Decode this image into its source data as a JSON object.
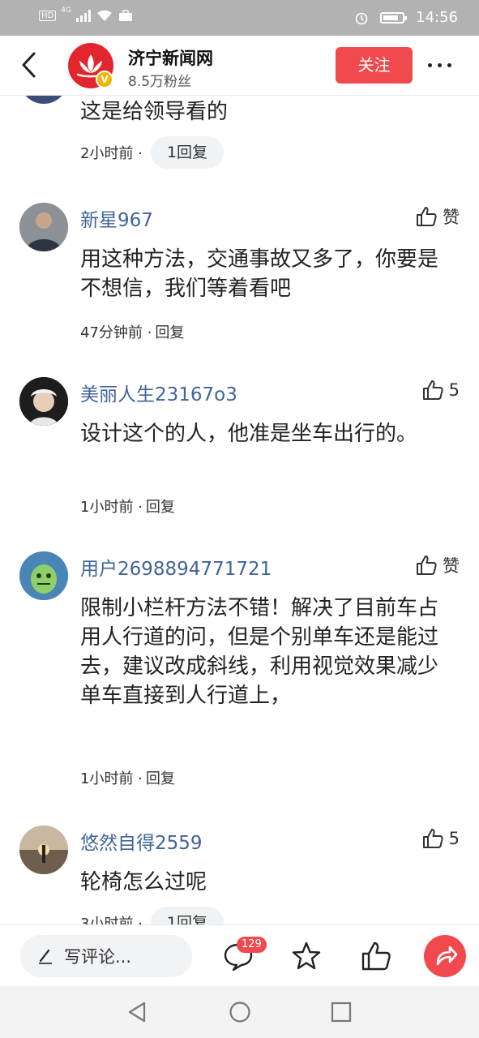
{
  "status_bar": {
    "network_label": "HD",
    "network_type": "4G",
    "time": "14:56"
  },
  "header": {
    "account_name": "济宁新闻网",
    "followers": "8.5万粉丝",
    "follow_label": "关注",
    "verified_mark": "V",
    "brand_color": "#f04a4e"
  },
  "comments": [
    {
      "username": "",
      "text": "这是给领导看的",
      "time": "2小时前 ·",
      "reply_label": "1回复",
      "reply_style": "pill"
    },
    {
      "username": "新星967",
      "like_label": "赞",
      "text": "用这种方法，交通事故又多了，你要是不想信，我们等着看吧",
      "time": "47分钟前 ·",
      "reply_label": "回复",
      "reply_style": "plain"
    },
    {
      "username": "美丽人生23167o3",
      "like_label": "5",
      "text": "设计这个的人，他准是坐车出行的。",
      "time": "1小时前 ·",
      "reply_label": "回复",
      "reply_style": "plain"
    },
    {
      "username": "用户2698894771721",
      "like_label": "赞",
      "text": "限制小栏杆方法不错！解决了目前车占用人行道的问，但是个别单车还是能过去，建议改成斜线，利用视觉效果减少单车直接到人行道上，",
      "time": "1小时前 ·",
      "reply_label": "回复",
      "reply_style": "plain"
    },
    {
      "username": "悠然自得2559",
      "like_label": "5",
      "text": "轮椅怎么过呢",
      "time": "3小时前 ·",
      "reply_label": "1回复",
      "reply_style": "pill"
    }
  ],
  "bottom_bar": {
    "write_placeholder": "写评论...",
    "comment_count": "129"
  },
  "icons": [
    "back-arrow-icon",
    "more-icon",
    "thumbs-up-icon",
    "pencil-icon",
    "comment-bubble-icon",
    "star-icon",
    "share-icon",
    "nav-back-icon",
    "nav-home-icon",
    "nav-recents-icon"
  ]
}
